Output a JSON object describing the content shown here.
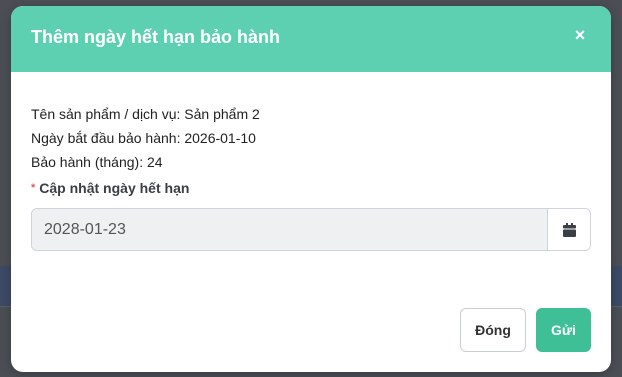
{
  "modal": {
    "title": "Thêm ngày hết hạn bảo hành",
    "close_symbol": "×"
  },
  "info": {
    "product": "Tên sản phẩm / dịch vụ: Sản phẩm 2",
    "warranty_start": "Ngày bắt đầu bảo hành: 2026-01-10",
    "warranty_months": "Bảo hành (tháng): 24"
  },
  "form": {
    "required_mark": "*",
    "expiry_label": "Cập nhật ngày hết hạn",
    "expiry_value": "2028-01-23",
    "calendar_icon": "calendar-icon"
  },
  "footer": {
    "close_label": "Đóng",
    "submit_label": "Gửi"
  },
  "colors": {
    "header": "#5cd0b0",
    "submit": "#3fbf96"
  }
}
